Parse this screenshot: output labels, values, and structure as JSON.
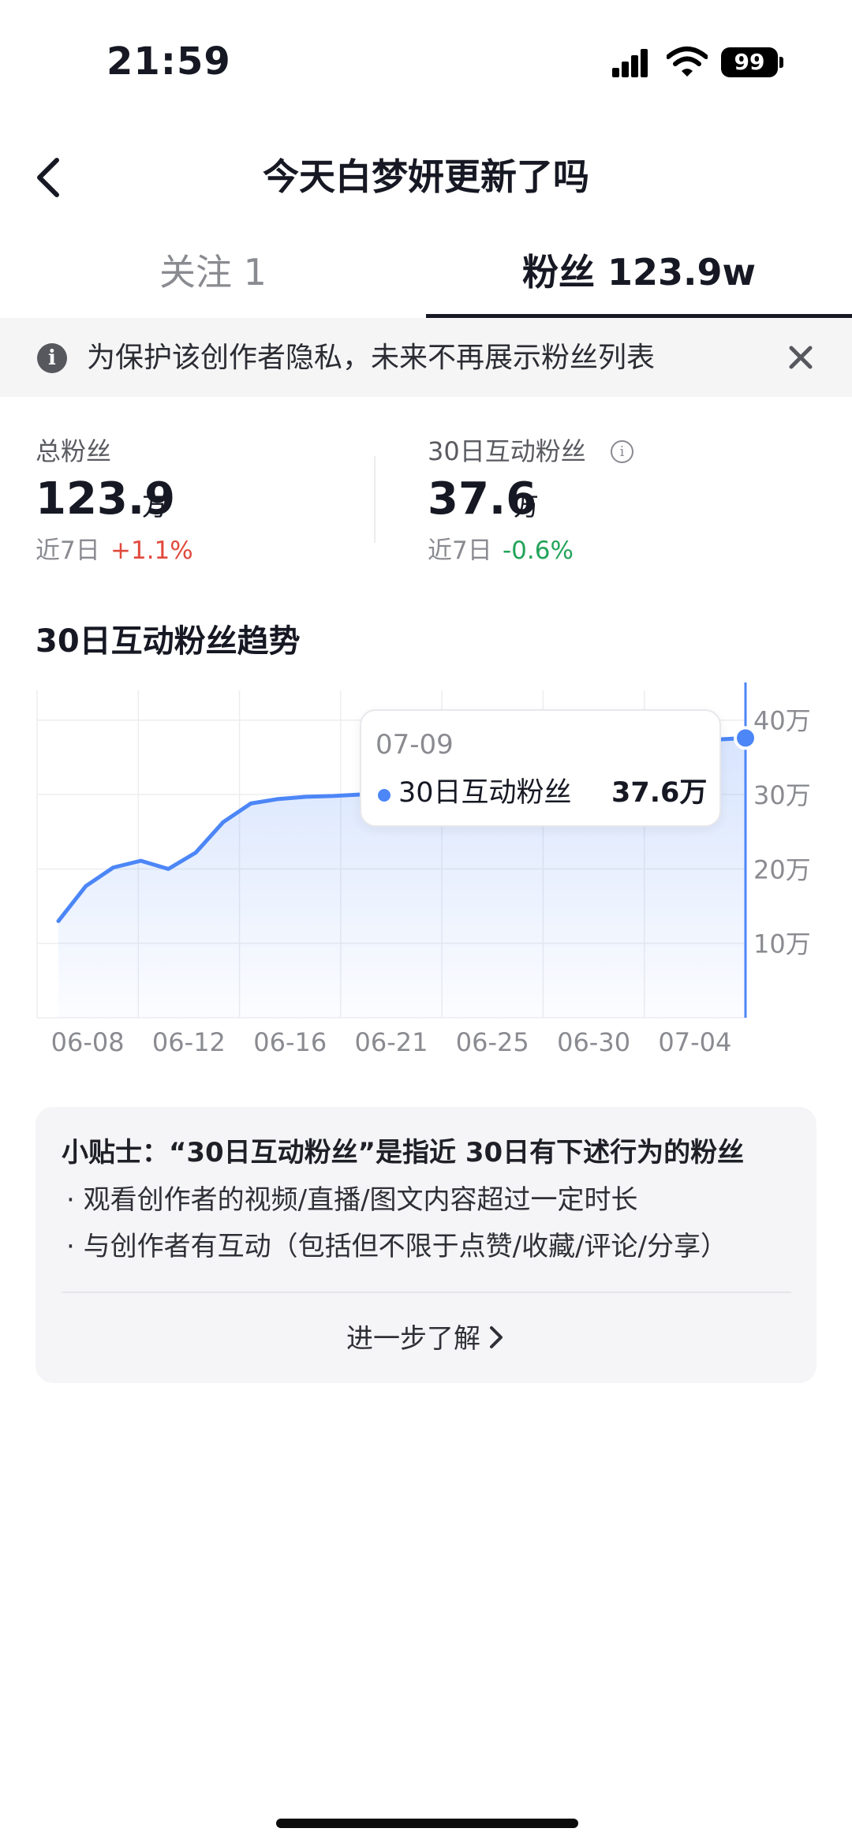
{
  "status_bar": {
    "time": "21:59",
    "battery": "99"
  },
  "header": {
    "title": "今天白梦妍更新了吗"
  },
  "tabs": {
    "follow": "关注 1",
    "fans": "粉丝 123.9w"
  },
  "notice": {
    "text": "为保护该创作者隐私，未来不再展示粉丝列表"
  },
  "stats": {
    "total": {
      "label": "总粉丝",
      "value": "123.9",
      "unit": "万",
      "period": "近7日",
      "change": "+1.1%"
    },
    "active": {
      "label": "30日互动粉丝",
      "value": "37.6",
      "unit": "万",
      "period": "近7日",
      "change": "-0.6%"
    }
  },
  "chart_section": {
    "title": "30日互动粉丝趋势"
  },
  "chart_data": {
    "type": "area",
    "title": "30日互动粉丝趋势",
    "x_tick_labels": [
      "06-08",
      "06-12",
      "06-16",
      "06-21",
      "06-25",
      "06-30",
      "07-04"
    ],
    "y_tick_labels": [
      "10万",
      "20万",
      "30万",
      "40万"
    ],
    "ylim": [
      0,
      44
    ],
    "grid": true,
    "series": [
      {
        "name": "30日互动粉丝",
        "color": "#4c86f7",
        "values": [
          13.0,
          17.7,
          20.2,
          21.1,
          20.0,
          22.2,
          26.3,
          28.8,
          29.4,
          29.7,
          29.8,
          30.0,
          31.0,
          31.4,
          32.0,
          33.5,
          34.5,
          35.3,
          35.9,
          36.5,
          37.3,
          37.7,
          37.9,
          38.0,
          37.4,
          37.6
        ]
      }
    ],
    "tooltip": {
      "date": "07-09",
      "series": "30日互动粉丝",
      "value": "37.6万"
    }
  },
  "tips": {
    "title": "小贴士：“30日互动粉丝”是指近 30日有下述行为的粉丝",
    "items": [
      "· 观看创作者的视频/直播/图文内容超过一定时长",
      "· 与创作者有互动（包括但不限于点赞/收藏/评论/分享）"
    ],
    "learn_more": "进一步了解"
  }
}
